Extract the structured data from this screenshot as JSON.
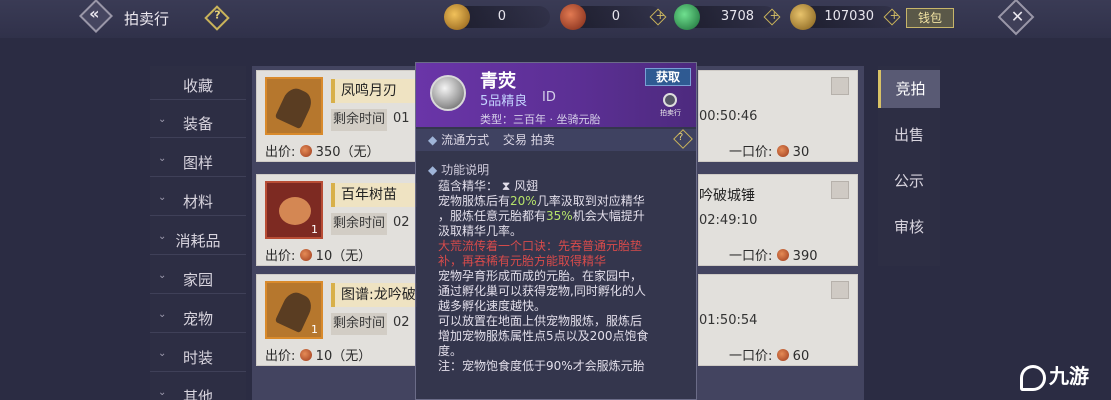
{
  "header": {
    "title": "拍卖行",
    "help_symbol": "?",
    "currencies": [
      {
        "icon": "gold-ingot-icon",
        "value": "0",
        "color": "#d79a2c"
      },
      {
        "icon": "red-coin-icon",
        "value": "0",
        "color": "#b84a2e"
      },
      {
        "icon": "jade-icon",
        "value": "3708",
        "color": "#2fa65a"
      },
      {
        "icon": "gold-leaf-icon",
        "value": "107030",
        "color": "#c69a3c"
      }
    ],
    "wallet_label": "钱包",
    "back_symbol": "«",
    "close_symbol": "✕"
  },
  "left_nav": [
    {
      "label": "收藏",
      "chevron": false
    },
    {
      "label": "装备",
      "chevron": true
    },
    {
      "label": "图样",
      "chevron": true
    },
    {
      "label": "材料",
      "chevron": true
    },
    {
      "label": "消耗品",
      "chevron": true
    },
    {
      "label": "家园",
      "chevron": true
    },
    {
      "label": "宠物",
      "chevron": true
    },
    {
      "label": "时装",
      "chevron": true
    },
    {
      "label": "其他",
      "chevron": true
    }
  ],
  "listings_left": [
    {
      "name": "凤鸣月刃",
      "remain_label": "剩余时间",
      "remain_time": "01",
      "price_label": "出价:",
      "price": "350（无）",
      "qty": ""
    },
    {
      "name": "百年树苗",
      "remain_label": "剩余时间",
      "remain_time": "02",
      "price_label": "出价:",
      "price": "10（无）",
      "qty": "1"
    },
    {
      "name": "图谱:龙吟破",
      "remain_label": "剩余时间",
      "remain_time": "02",
      "price_label": "出价:",
      "price": "10（无）",
      "qty": "1"
    }
  ],
  "listings_right": [
    {
      "name_fragment": "",
      "time": "00:50:46",
      "price_label": "一口价:",
      "price": "30"
    },
    {
      "name_fragment": "吟破城锤",
      "time": "02:49:10",
      "price_label": "一口价:",
      "price": "390"
    },
    {
      "name_fragment": "",
      "time": "01:50:54",
      "price_label": "一口价:",
      "price": "60"
    }
  ],
  "side_nav": [
    {
      "label": "竞拍",
      "active": true
    },
    {
      "label": "出售",
      "active": false
    },
    {
      "label": "公示",
      "active": false
    },
    {
      "label": "审核",
      "active": false
    }
  ],
  "popup": {
    "name": "青荧",
    "grade": "5品精良",
    "id_label": "ID",
    "type": "类型：三百年 · 坐骑元胎",
    "obtain_label": "获取",
    "source_label": "拍卖行",
    "trade_label": "流通方式",
    "trade_value": "交易 拍卖",
    "function_header": "功能说明",
    "essence_label": "蕴含精华：",
    "essence_value": "风翅",
    "line1_a": "宠物服炼后有",
    "line1_b": "20%",
    "line1_c": "几率汲取到对应精华",
    "line2_a": "，服炼任意元胎都有",
    "line2_b": "35%",
    "line2_c": "机会大幅提升",
    "line3": "汲取精华几率。",
    "red1": "大荒流传着一个口诀：先吞普通元胎垫",
    "red2": "补，再吞稀有元胎方能取得精华",
    "p1": "宠物孕育形成而成的元胎。在家园中，",
    "p2": "通过孵化巢可以获得宠物,同时孵化的人",
    "p3": "越多孵化速度越快。",
    "p4": "可以放置在地面上供宠物服炼，服炼后",
    "p5": "增加宠物服炼属性点5点以及200点饱食",
    "p6": "度。",
    "p7": "注：宠物饱食度低于90%才会服炼元胎"
  },
  "watermark": "九游"
}
